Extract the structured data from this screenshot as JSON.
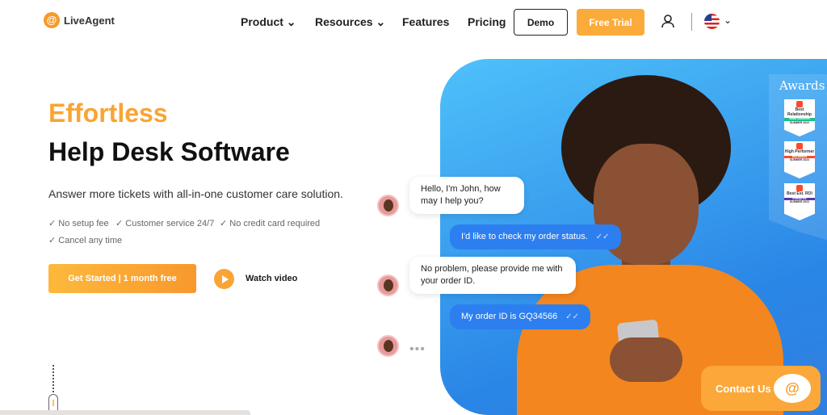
{
  "nav": {
    "brand": "LiveAgent",
    "items": [
      "Product",
      "Resources",
      "Features",
      "Pricing"
    ],
    "demo": "Demo",
    "free_trial": "Free Trial"
  },
  "hero": {
    "title_accent": "Effortless",
    "title": "Help Desk Software",
    "subtitle": "Answer more tickets with all-in-one customer care solution.",
    "features": [
      "✓ No setup fee",
      "✓ Customer service 24/7",
      "✓ No credit card required",
      "✓ Cancel any time"
    ],
    "cta": "Get Started | 1 month free",
    "watch": "Watch video"
  },
  "chat": [
    {
      "from": "agent",
      "text": "Hello, I'm John, how may I help you?"
    },
    {
      "from": "user",
      "text": "I'd like to check my order status."
    },
    {
      "from": "agent",
      "text": "No problem, please provide me with your order ID."
    },
    {
      "from": "user",
      "text": "My order ID is GQ34566"
    }
  ],
  "awards": {
    "title": "Awards",
    "badges": [
      {
        "title": "Best Relationship",
        "tag": "Small Business",
        "season": "SUMMER 2022",
        "color": "#1dbf8a"
      },
      {
        "title": "High Performer",
        "tag": "Mid-Market",
        "season": "SUMMER 2022",
        "color": "#ff492c"
      },
      {
        "title": "Best Est. ROI",
        "tag": "Enterprise",
        "season": "SUMMER 2022",
        "color": "#5a39a8"
      }
    ]
  },
  "contact": {
    "label": "Contact Us"
  },
  "colors": {
    "accent": "#f9a433",
    "chat_blue": "#2d7ff0"
  }
}
